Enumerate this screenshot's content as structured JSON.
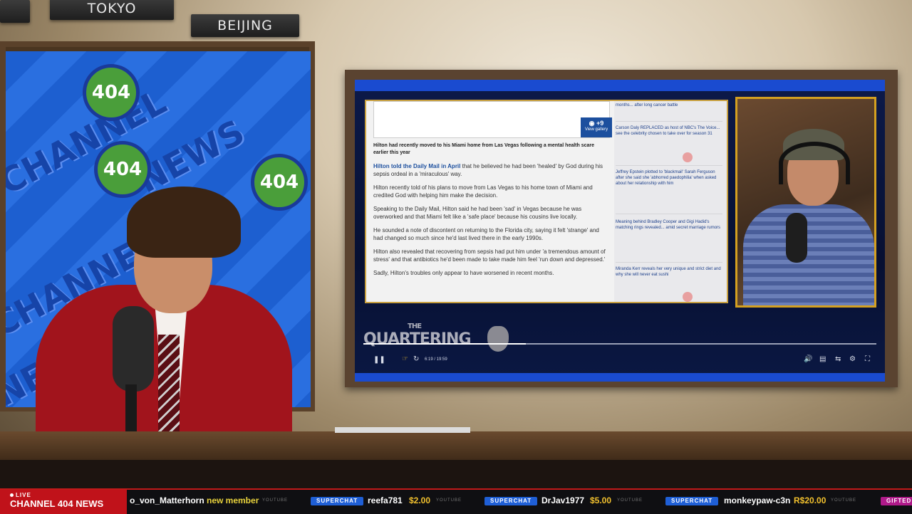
{
  "city_labels": [
    "TOKYO",
    "BEIJING"
  ],
  "wall": {
    "texts": [
      "CHANNEL",
      "NEWS",
      "CHANNEL",
      "NEWS"
    ],
    "logo_text": "404"
  },
  "article": {
    "gallery_count": "+9",
    "gallery_label": "View gallery",
    "caption": "Hilton had recently moved to his Miami home from Las Vegas following a mental health scare earlier this year",
    "link_text": "Hilton told the Daily Mail in April",
    "paragraph1_rest": " that he believed he had been 'healed' by God during his sepsis ordeal in a 'miraculous' way.",
    "paragraph2": "Hilton recently told of his plans to move from Las Vegas to his home town of Miami and credited God with helping him make the decision.",
    "paragraph3": "Speaking to the Daily Mail, Hilton said he had been 'sad' in Vegas because he was overworked and that Miami felt like a 'safe place' because his cousins live locally.",
    "paragraph4": "He sounded a note of discontent on returning to the Florida city, saying it felt 'strange' and had changed so much since he'd last lived there in the early 1990s.",
    "paragraph5": "Hilton also revealed that recovering from sepsis had put him under 'a tremendous amount of stress' and that antibiotics he'd been made to take made him feel 'run down and depressed.'",
    "paragraph6": "Sadly, Hilton's troubles only appear to have worsened in recent months."
  },
  "sidebar": {
    "items": [
      "months... after long cancer battle",
      "Carson Daly REPLACED as host of NBC's The Voice... see the celebrity chosen to take over for season 31",
      "Jeffrey Epstein plotted to 'blackmail' Sarah Ferguson after she said she 'abhorred paedophilia' when asked about her relationship with him",
      "Meaning behind Bradley Cooper and Gigi Hadid's matching rings revealed... amid secret marriage rumors",
      "Miranda Kerr reveals her very unique and strict diet and why she will never eat sushi"
    ]
  },
  "player": {
    "logo_top": "THE",
    "logo_main": "QUARTERING",
    "time": "6:19 / 19:59",
    "progress_fraction": 0.316,
    "icons": [
      "pause-icon",
      "hand-cursor-icon",
      "replay-icon",
      "volume-icon",
      "captions-icon",
      "speed-icon",
      "settings-icon",
      "fullscreen-icon"
    ]
  },
  "ticker": {
    "live_label": "LIVE",
    "brand": "CHANNEL 404 NEWS",
    "items": [
      {
        "type": "member",
        "user": "o_von_Matterhorn",
        "text": "new member",
        "source": "YOUTUBE"
      },
      {
        "type": "superchat",
        "badge": "SUPERCHAT",
        "user": "reefa781",
        "amount": "$2.00",
        "source": "YOUTUBE"
      },
      {
        "type": "superchat",
        "badge": "SUPERCHAT",
        "user": "DrJav1977",
        "amount": "$5.00",
        "source": "YOUTUBE"
      },
      {
        "type": "superchat",
        "badge": "SUPERCHAT",
        "user": "monkeypaw-c3n",
        "amount": "R$20.00",
        "source": "YOUTUBE"
      },
      {
        "type": "gifted",
        "badge": "GIFTED"
      }
    ]
  },
  "colors": {
    "ticker_red": "#c0121a",
    "superchat_blue": "#1f5fd6",
    "amount_gold": "#f2c12e",
    "wall_blue": "#1d5fd0"
  }
}
